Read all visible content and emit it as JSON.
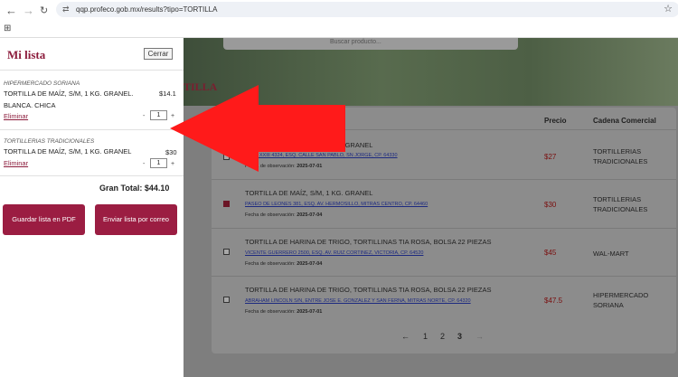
{
  "browser": {
    "url": "qqp.profeco.gob.mx/results?tipo=TORTILLA"
  },
  "hero": {
    "search_placeholder": "Buscar producto...",
    "title": "TILLA"
  },
  "table": {
    "headers": {
      "price": "Precio",
      "chain": "Cadena Comercial"
    },
    "date_label": "Fecha de observación:",
    "rows": [
      {
        "name": "TORTILLA DE MAÍZ, S/M, 1 KG. GRANEL",
        "address": "JUAN XXIII 4324, ESQ. CALLE SAN PABLO, SN JORGE, CP. 64330",
        "date": "2025-07-01",
        "price": "$27",
        "chain": "TORTILLERIAS TRADICIONALES",
        "checked": false
      },
      {
        "name": "TORTILLA DE MAÍZ, S/M, 1 KG. GRANEL",
        "address": "PASEO DE LEONES 381, ESQ. AV. HERMOSILLO, MITRAS CENTRO, CP. 64460",
        "date": "2025-07-04",
        "price": "$30",
        "chain": "TORTILLERIAS TRADICIONALES",
        "checked": true
      },
      {
        "name": "TORTILLA DE HARINA DE TRIGO, TORTILLINAS TIA ROSA, BOLSA 22 PIEZAS",
        "address": "VICENTE GUERRERO 2500, ESQ. AV. RUIZ CORTINEZ, VICTORIA, CP. 64520",
        "date": "2025-07-04",
        "price": "$45",
        "chain": "WAL-MART",
        "checked": false
      },
      {
        "name": "TORTILLA DE HARINA DE TRIGO, TORTILLINAS TIA ROSA, BOLSA 22 PIEZAS",
        "address": "ABRAHAM LINCOLN S/N, ENTRE JOSE E. GONZALEZ Y SAN FERNA, MITRAS NORTE, CP. 64320",
        "date": "2025-07-01",
        "price": "$47.5",
        "chain": "HIPERMERCADO SORIANA",
        "checked": false
      }
    ]
  },
  "pagination": {
    "prev": "←",
    "pages": [
      "1",
      "2",
      "3"
    ],
    "current": "3",
    "next": "→"
  },
  "sidebar": {
    "title": "Mi lista",
    "close_label": "Cerrar",
    "remove_label": "Eliminar",
    "items": [
      {
        "store": "HIPERMERCADO SORIANA",
        "name": "TORTILLA DE MAÍZ, S/M, 1 KG. GRANEL. BLANCA. CHICA",
        "price": "$14.1",
        "qty": "1"
      },
      {
        "store": "TORTILLERIAS TRADICIONALES",
        "name": "TORTILLA DE MAÍZ, S/M, 1 KG. GRANEL",
        "price": "$30",
        "qty": "1"
      }
    ],
    "total": "Gran Total: $44.10",
    "pdf_label": "Guardar lista en PDF",
    "email_label": "Enviar lista por correo"
  },
  "colors": {
    "brand": "#9b1d42",
    "arrow": "#ff1a1a",
    "price_red": "#7a0e0e"
  }
}
